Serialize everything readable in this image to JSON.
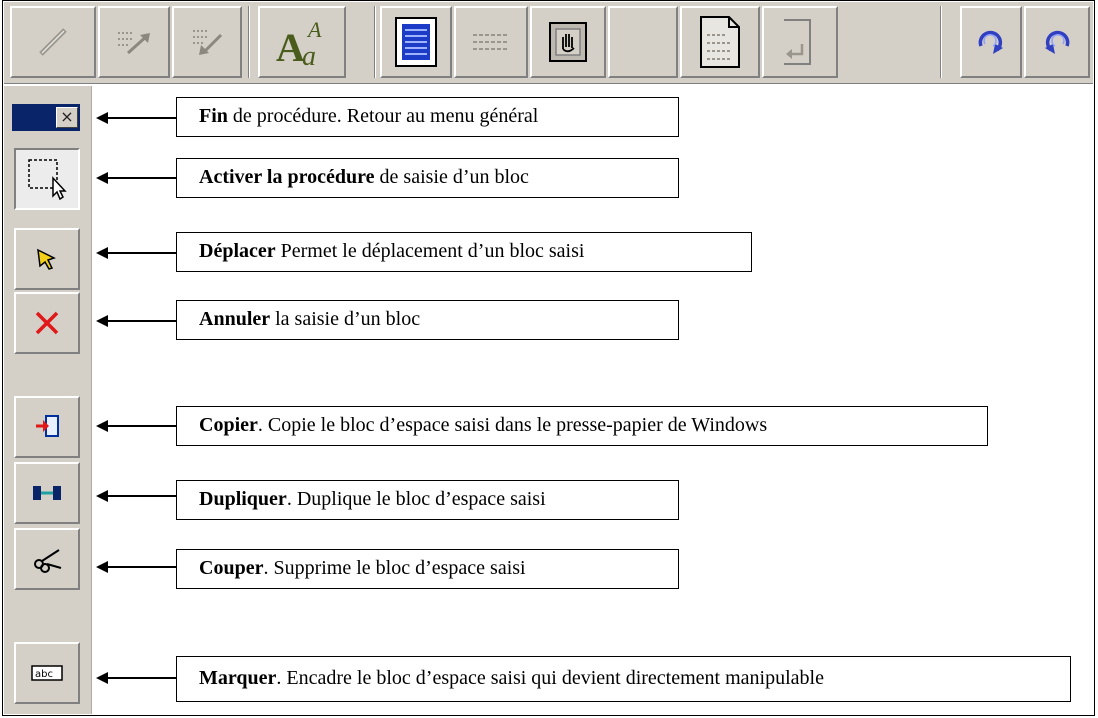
{
  "toolbar": {
    "buttons": [
      {
        "name": "pencil-icon"
      },
      {
        "name": "export-right-icon"
      },
      {
        "name": "import-left-icon"
      },
      {
        "name": "font-icon"
      },
      {
        "name": "document-icon"
      },
      {
        "name": "lines-icon"
      },
      {
        "name": "hand-icon"
      },
      {
        "name": "blank-icon"
      },
      {
        "name": "page-icon"
      },
      {
        "name": "page-return-icon"
      },
      {
        "name": "rotate-right-icon"
      },
      {
        "name": "rotate-left-icon"
      }
    ]
  },
  "font_icon_text": {
    "big": "A",
    "sub": "a",
    "sup": "A"
  },
  "side_close": "×",
  "side_abc": "abc",
  "callouts": [
    {
      "bold": "Fin",
      "rest": " de procédure. Retour au menu général"
    },
    {
      "bold": "Activer la procédure",
      "rest": " de saisie d’un bloc"
    },
    {
      "bold": "Déplacer",
      "rest": "  Permet le déplacement d’un bloc saisi"
    },
    {
      "bold": "Annuler",
      "rest": " la saisie d’un bloc"
    },
    {
      "bold": "Copier",
      "rest": ". Copie le bloc d’espace saisi dans le presse-papier de Windows"
    },
    {
      "bold": "Dupliquer",
      "rest": ". Duplique le bloc d’espace saisi"
    },
    {
      "bold": "Couper",
      "rest": ". Supprime le bloc d’espace saisi"
    },
    {
      "bold": "Marquer",
      "rest": ". Encadre le bloc d’espace saisi qui devient directement manipulable"
    }
  ]
}
